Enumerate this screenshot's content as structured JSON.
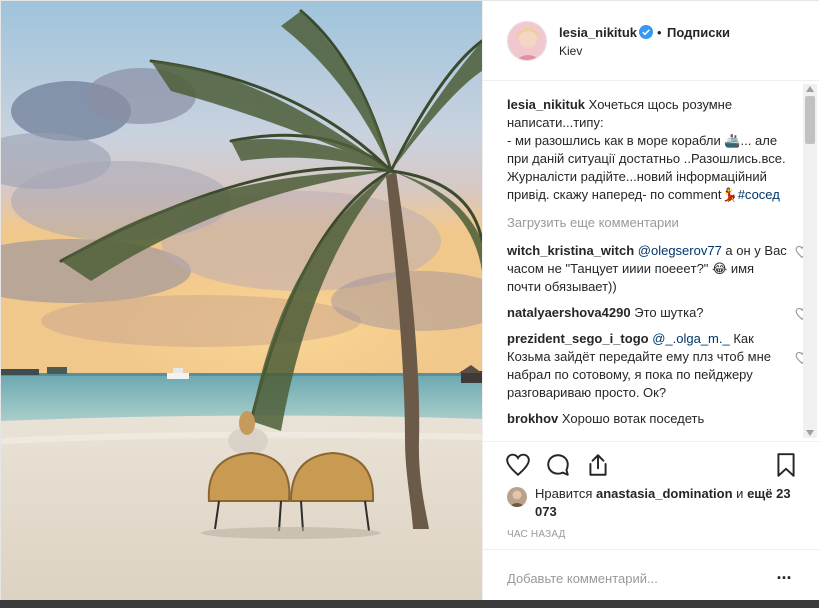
{
  "header": {
    "username": "lesia_nikituk",
    "separator": "•",
    "follow_label": "Подписки",
    "location": "Kiev"
  },
  "caption": {
    "username": "lesia_nikituk",
    "text": "Хочеться щось розумне написати...типу:\n- ми разошлись как в море корабли 🚢... але при даній ситуації достатньо ..Разошлись.все. Журналісти радійте...новий інформаційний привід. скажу наперед- по comment💃",
    "hashtag": "#сосед"
  },
  "load_more_label": "Загрузить еще комментарии",
  "comments": [
    {
      "username": "witch_kristina_witch",
      "mention": "@olegserov77",
      "text": " а он у Вас часом не \"Танцует ииии поееeт?\" 😂 имя почти обязывает))"
    },
    {
      "username": "natalyaershova4290",
      "mention": "",
      "text": "Это шутка?"
    },
    {
      "username": "prezident_sego_i_togo",
      "mention": "@_.olga_m._",
      "text": " Как Козьма зайдёт передайте ему плз чтоб мне набрал по сотовому, я пока по пейджеру разговариваю просто. Ок?"
    },
    {
      "username": "brokhov",
      "mention": "",
      "text": " Хорошо вотак поседеть"
    }
  ],
  "likes": {
    "prefix": "Нравится",
    "user": "anastasia_domination",
    "and": "и",
    "others": "ещё 23 073"
  },
  "time_ago": "ЧАС НАЗАД",
  "add_comment_placeholder": "Добавьте комментарий...",
  "more_label": "...",
  "colors": {
    "link": "#003569",
    "muted": "#999999",
    "verified": "#3897f0"
  }
}
